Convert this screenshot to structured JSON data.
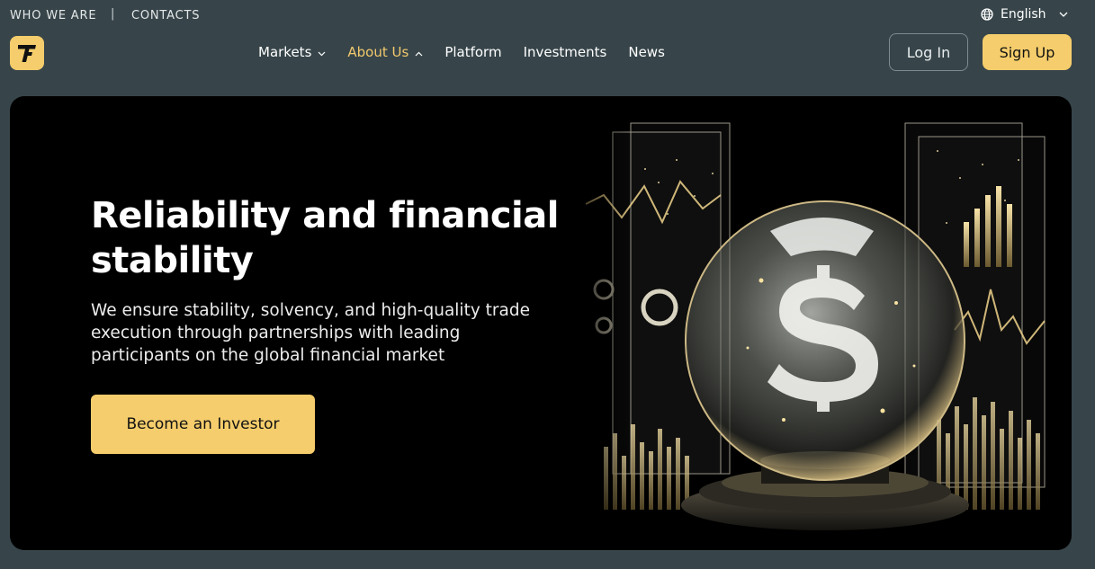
{
  "topbar": {
    "who_we_are": "WHO WE ARE",
    "separator": "|",
    "contacts": "CONTACTS",
    "language": "English"
  },
  "nav": {
    "items": [
      {
        "label": "Markets",
        "has_dropdown": true,
        "active": false
      },
      {
        "label": "About Us",
        "has_dropdown": true,
        "active": true
      },
      {
        "label": "Platform",
        "has_dropdown": false,
        "active": false
      },
      {
        "label": "Investments",
        "has_dropdown": false,
        "active": false
      },
      {
        "label": "News",
        "has_dropdown": false,
        "active": false
      }
    ],
    "login_label": "Log In",
    "signup_label": "Sign Up"
  },
  "hero": {
    "title": "Reliability and financial stability",
    "subtitle": "We ensure stability, solvency, and high-quality trade execution through partnerships with leading participants on the global financial market",
    "cta_label": "Become an Investor",
    "image_subject": "glass sphere with dollar sign among glowing financial charts"
  },
  "icons": {
    "logo": "logo-icon",
    "globe": "globe-icon",
    "chevron_down": "chevron-down-icon",
    "chevron_up": "chevron-up-icon"
  },
  "colors": {
    "page_background": "#37454a",
    "accent": "#f5cd6c",
    "active_nav": "#f2c86c",
    "hero_background": "#000000"
  }
}
